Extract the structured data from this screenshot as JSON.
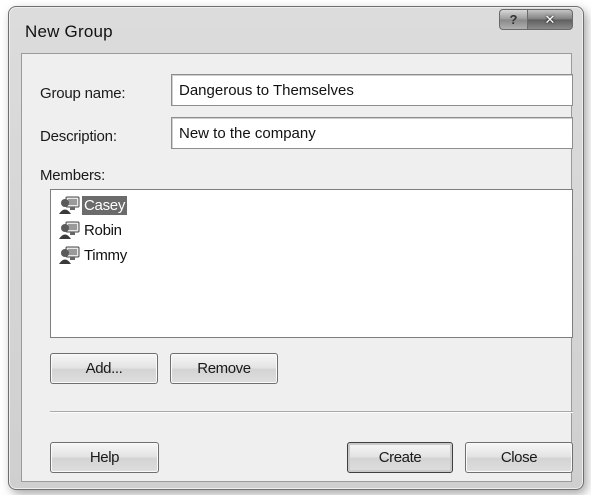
{
  "window": {
    "title": "New Group",
    "help_glyph": "?",
    "close_glyph": "✕"
  },
  "form": {
    "group_name_label": "Group name:",
    "group_name_value": "Dangerous to Themselves",
    "description_label": "Description:",
    "description_value": "New to the company",
    "members_label": "Members:"
  },
  "members": [
    {
      "name": "Casey",
      "selected": true,
      "icon": "user-computer-icon"
    },
    {
      "name": "Robin",
      "selected": false,
      "icon": "user-computer-icon"
    },
    {
      "name": "Timmy",
      "selected": false,
      "icon": "user-computer-icon"
    }
  ],
  "buttons": {
    "add": "Add...",
    "remove": "Remove",
    "help": "Help",
    "create": "Create",
    "close": "Close"
  },
  "colors": {
    "selection": "#6b6b6b",
    "window_bg": "#cfcfcf",
    "client_bg": "#efefef"
  }
}
